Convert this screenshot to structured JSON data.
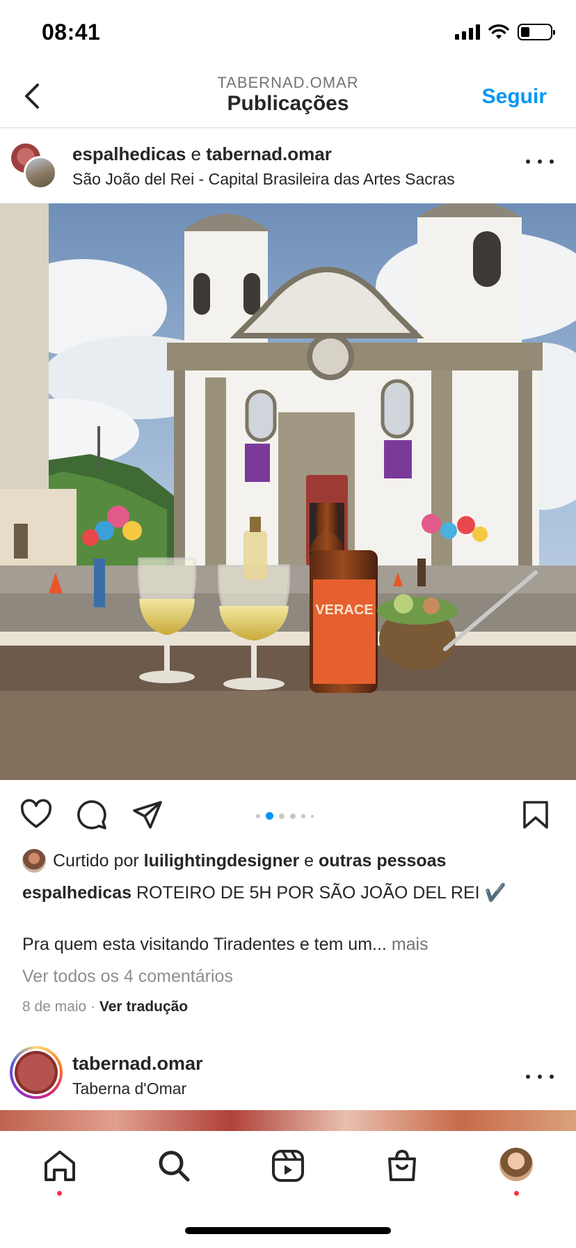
{
  "status_bar": {
    "time": "08:41"
  },
  "nav": {
    "subtitle": "TABERNAD.OMAR",
    "title": "Publicações",
    "follow_label": "Seguir"
  },
  "post": {
    "user_prefix": "espalhedicas",
    "user_joiner": " e ",
    "user_second": "tabernad.omar",
    "location": "São João del Rei - Capital Brasileira das Artes Sacras",
    "carousel": {
      "count": 6,
      "active_index": 1
    },
    "likes_prefix": "Curtido por ",
    "likes_user": "luilightingdesigner",
    "likes_joiner": " e ",
    "likes_rest": "outras pessoas",
    "caption_user": "espalhedicas",
    "caption_text": " ROTEIRO DE 5H POR SÃO JOÃO DEL REI ✔️",
    "caption_line2": "Pra quem esta visitando Tiradentes e tem um...",
    "caption_more": " mais",
    "comments_link": "Ver todos os 4 comentários",
    "date": "8 de maio",
    "separator": " · ",
    "translate": "Ver tradução",
    "photo_bottle_text": "VERACE"
  },
  "next_post": {
    "user": "tabernad.omar",
    "subtitle": "Taberna d'Omar"
  },
  "colors": {
    "accent": "#0095f6",
    "text": "#262626",
    "muted": "#8e8e8e",
    "notification": "#ff3040"
  },
  "tabs": [
    "home-icon",
    "search-icon",
    "reels-icon",
    "shop-icon",
    "profile-avatar"
  ]
}
